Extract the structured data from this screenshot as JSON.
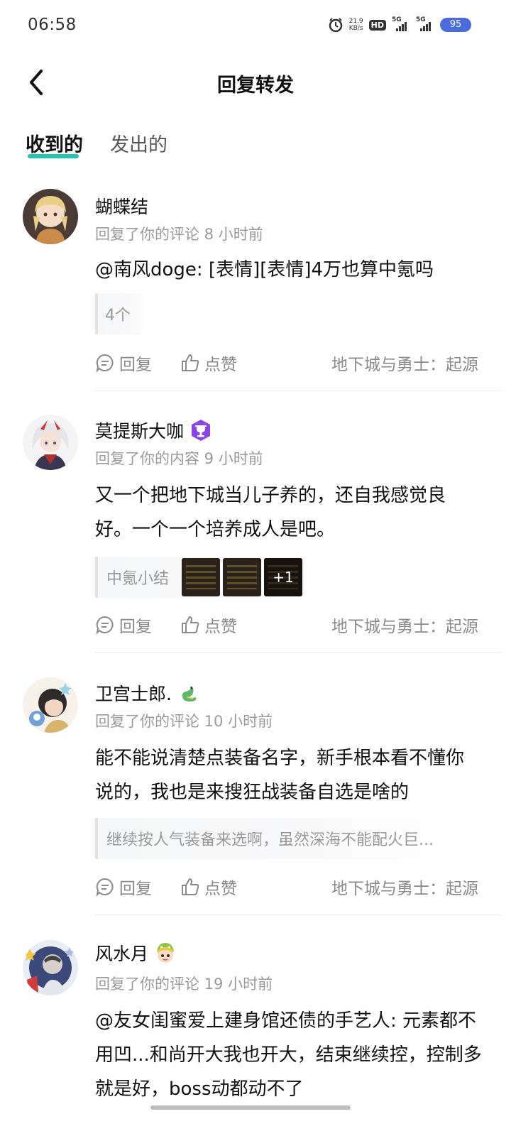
{
  "status_bar": {
    "time": "06:58",
    "net_speed_value": "21.9",
    "net_speed_unit": "KB/s",
    "hd_label": "HD",
    "sim1_label": "5G",
    "sim2_label": "5G",
    "battery": "95",
    "icons": [
      "alarm-icon",
      "hd-icon",
      "signal-icon",
      "signal-icon",
      "battery-icon"
    ]
  },
  "header": {
    "title": "回复转发",
    "back_icon": "chevron-left-icon"
  },
  "tabs": [
    {
      "label": "收到的",
      "active": true
    },
    {
      "label": "发出的",
      "active": false
    }
  ],
  "accent_color": "#23c4b4",
  "actions": {
    "reply": "回复",
    "like": "点赞"
  },
  "comments": [
    {
      "username": "蝴蝶结",
      "meta": "回复了你的评论 8 小时前",
      "text": "@南风doge: [表情][表情]4万也算中氪吗",
      "quote": "4个",
      "source": "地下城与勇士：起源"
    },
    {
      "username": "莫提斯大咖",
      "meta": "回复了你的内容 9 小时前",
      "text": "又一个把地下城当儿子养的，还自我感觉良好。一个一个培养成人是吧。",
      "quote": "中氪小结",
      "more_images": "+1",
      "source": "地下城与勇士：起源"
    },
    {
      "username": "卫宫士郎.",
      "meta": "回复了你的评论 10 小时前",
      "text": "能不能说清楚点装备名字，新手根本看不懂你说的，我也是来搜狂战装备自选是啥的",
      "quote": "继续按人气装备来选啊，虽然深海不能配火巨...",
      "source": "地下城与勇士：起源"
    },
    {
      "username": "风水月",
      "meta": "回复了你的评论 19 小时前",
      "text": "@友女闺蜜爱上建身馆还债的手艺人: 元素都不用凹...和尚开大我也开大，结束继续控，控制多就是好，boss动都动不了"
    }
  ]
}
